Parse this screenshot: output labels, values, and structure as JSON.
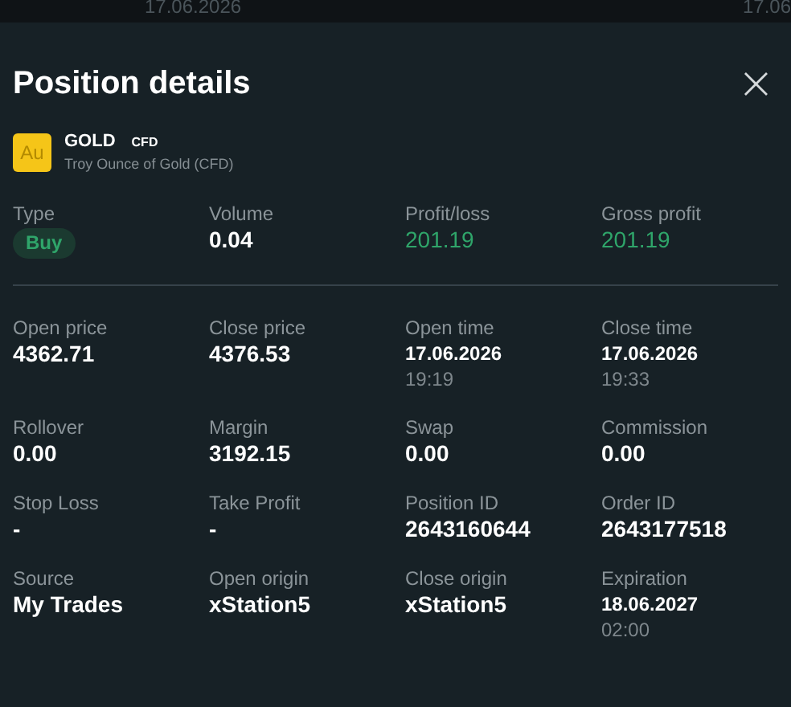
{
  "background_strip": {
    "texts": [
      "17.06.2026",
      "17.06"
    ]
  },
  "dialog": {
    "title": "Position details",
    "close_label": "×"
  },
  "instrument": {
    "badge": "Au",
    "symbol": "GOLD",
    "type_tag": "CFD",
    "description": "Troy Ounce of Gold (CFD)"
  },
  "sections": [
    {
      "fields": [
        {
          "label": "Type",
          "kind": "side",
          "value": "Buy"
        },
        {
          "label": "Volume",
          "kind": "plain",
          "value": "0.04"
        },
        {
          "label": "Profit/loss",
          "kind": "positive",
          "value": "201.19"
        },
        {
          "label": "Gross profit",
          "kind": "positive",
          "value": "201.19"
        }
      ]
    },
    {
      "fields": [
        {
          "label": "Open price",
          "kind": "plain",
          "value": "4362.71"
        },
        {
          "label": "Close price",
          "kind": "plain",
          "value": "4376.53"
        },
        {
          "label": "Open time",
          "kind": "datetime",
          "value": "17.06.2026",
          "time": "19:19"
        },
        {
          "label": "Close time",
          "kind": "datetime",
          "value": "17.06.2026",
          "time": "19:33"
        },
        {
          "label": "Rollover",
          "kind": "plain",
          "value": "0.00"
        },
        {
          "label": "Margin",
          "kind": "plain",
          "value": "3192.15"
        },
        {
          "label": "Swap",
          "kind": "plain",
          "value": "0.00"
        },
        {
          "label": "Commission",
          "kind": "plain",
          "value": "0.00"
        },
        {
          "label": "Stop Loss",
          "kind": "plain",
          "value": "-"
        },
        {
          "label": "Take Profit",
          "kind": "plain",
          "value": "-"
        },
        {
          "label": "Position ID",
          "kind": "plain",
          "value": "2643160644"
        },
        {
          "label": "Order ID",
          "kind": "plain",
          "value": "2643177518"
        },
        {
          "label": "Source",
          "kind": "plain",
          "value": "My Trades"
        },
        {
          "label": "Open origin",
          "kind": "plain",
          "value": "xStation5"
        },
        {
          "label": "Close origin",
          "kind": "plain",
          "value": "xStation5"
        },
        {
          "label": "Expiration",
          "kind": "datetime",
          "value": "18.06.2027",
          "time": "02:00"
        }
      ]
    }
  ]
}
